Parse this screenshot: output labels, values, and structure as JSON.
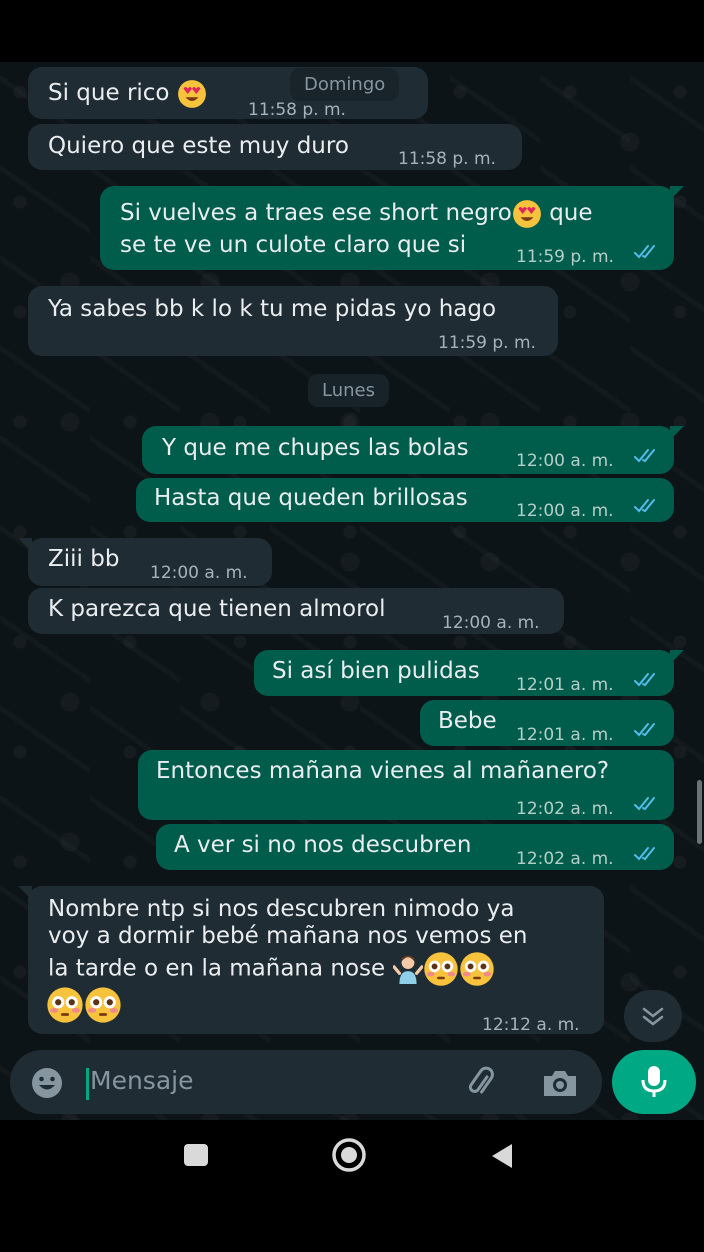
{
  "header": {
    "day_label": "Domingo"
  },
  "messages": [
    {
      "text": "Si que rico",
      "time": "11:58 p. m."
    },
    {
      "text": "Quiero que este muy duro",
      "time": "11:58 p. m."
    },
    {
      "line1a": "Si vuelves a traes ese short negro",
      "line1b": "que",
      "line2": "se te ve un culote claro que si",
      "time": "11:59 p. m."
    },
    {
      "text": "Ya sabes bb k lo k tu me pidas yo hago",
      "time": "11:59 p. m."
    },
    {
      "text": "Y que me chupes las bolas",
      "time": "12:00 a. m."
    },
    {
      "text": "Hasta que queden brillosas",
      "time": "12:00 a. m."
    },
    {
      "text": "Ziii bb",
      "time": "12:00 a. m."
    },
    {
      "text": "K parezca que tienen almorol",
      "time": "12:00 a. m."
    },
    {
      "text": "Si así bien pulidas",
      "time": "12:01 a. m."
    },
    {
      "text": "Bebe",
      "time": "12:01 a. m."
    },
    {
      "text": "Entonces mañana vienes al mañanero?",
      "time": "12:02 a. m."
    },
    {
      "text": "A ver si no nos descubren",
      "time": "12:02 a. m."
    },
    {
      "line1": "Nombre ntp si nos descubren nimodo ya",
      "line2": "voy a dormir bebé mañana nos vemos en",
      "line3": "la tarde o en la mañana nose",
      "time": "12:12 a. m."
    }
  ],
  "day_separator": "Lunes",
  "composer": {
    "placeholder": "Mensaje"
  },
  "colors": {
    "incoming": "#202c33",
    "outgoing": "#005c4b",
    "accent": "#00a884",
    "read_ticks": "#53bdeb"
  },
  "icons": [
    "emoji-icon",
    "attach-icon",
    "camera-icon",
    "mic-icon",
    "chevron-down-icon",
    "square-nav-icon",
    "home-nav-icon",
    "back-nav-icon"
  ]
}
